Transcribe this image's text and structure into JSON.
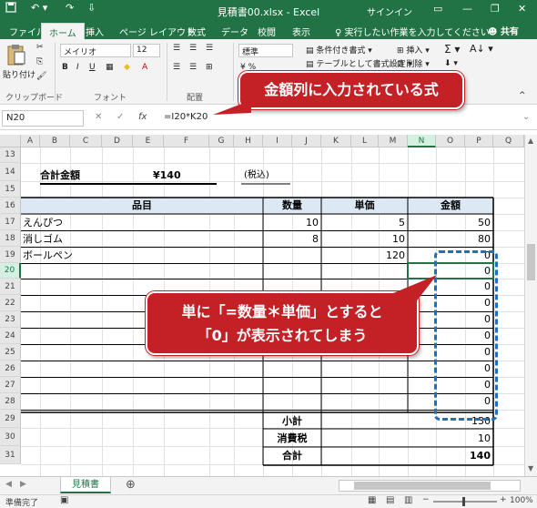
{
  "window": {
    "title": "見積書00.xlsx - Excel",
    "signin": "サインイン",
    "colors": {
      "excel_green": "#217346",
      "callout_red": "#c42127",
      "dash_blue": "#1f6fc0"
    }
  },
  "tabs": {
    "items": [
      "ファイル",
      "ホーム",
      "挿入",
      "ページ レイアウト",
      "数式",
      "データ",
      "校閲",
      "表示"
    ],
    "active": "ホーム",
    "tell_me": "♀ 実行したい作業を入力してください",
    "share": "共有"
  },
  "ribbon": {
    "paste": "貼り付け",
    "font_name": "メイリオ",
    "font_size": "12",
    "number_format": "標準",
    "cond_format": "条件付き書式 ▾",
    "table_format": "テーブルとして書式設定 ▾",
    "insert": "挿入 ▾",
    "delete": "削除 ▾",
    "groups": {
      "clipboard": "クリップボード",
      "font": "フォント",
      "alignment": "配置"
    }
  },
  "formula_bar": {
    "name_box": "N20",
    "formula": "=I20*K20"
  },
  "columns": [
    "A",
    "B",
    "C",
    "D",
    "E",
    "F",
    "G",
    "H",
    "I",
    "J",
    "K",
    "L",
    "M",
    "N",
    "O",
    "P",
    "Q"
  ],
  "rows": [
    "13",
    "14",
    "15",
    "16",
    "17",
    "18",
    "19",
    "20",
    "21",
    "22",
    "23",
    "24",
    "25",
    "26",
    "27",
    "28",
    "29",
    "30",
    "31"
  ],
  "sheet": {
    "total_label": "合計金額",
    "total_value": "¥140",
    "tax_note": "(税込)",
    "header_item": "品目",
    "header_qty": "数量",
    "header_price": "単価",
    "header_amount": "金額",
    "items": [
      {
        "name": "えんぴつ",
        "qty": "10",
        "price": "5",
        "amount": "50"
      },
      {
        "name": "消しゴム",
        "qty": "8",
        "price": "10",
        "amount": "80"
      },
      {
        "name": "ボールペン",
        "qty": "",
        "price": "120",
        "amount": "0"
      }
    ],
    "empty_amounts": [
      "0",
      "0",
      "0",
      "0",
      "0",
      "0",
      "0",
      "0",
      "0"
    ],
    "subtotal_label": "小計",
    "subtotal": "130",
    "tax_label": "消費税",
    "tax": "10",
    "grand_label": "合計",
    "grand": "140"
  },
  "callouts": {
    "top": "金額列に入力されている式",
    "middle_line1": "単に「=数量＊単価」とすると",
    "middle_line2": "「0」が表示されてしまう"
  },
  "sheet_tabs": {
    "active": "見積書",
    "add": "⊕"
  },
  "status": {
    "ready": "準備完了",
    "zoom": "100%"
  }
}
